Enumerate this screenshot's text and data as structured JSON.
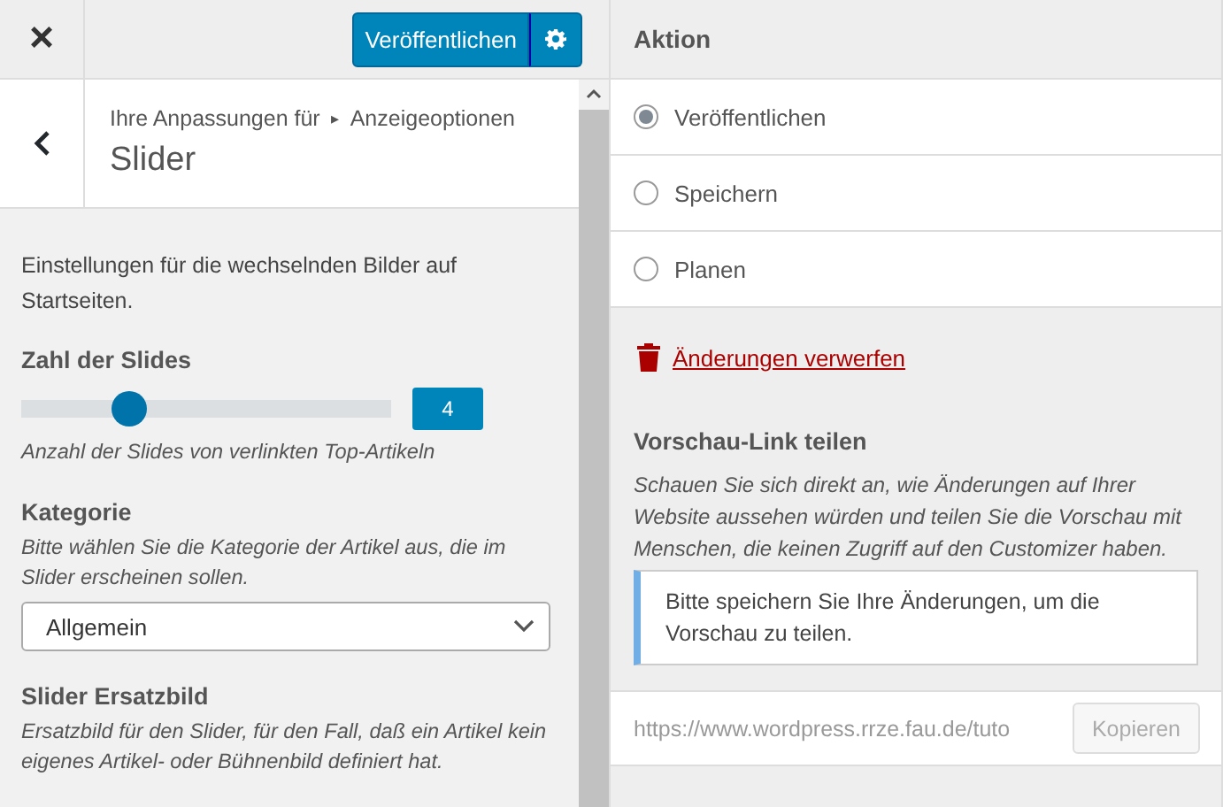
{
  "header": {
    "close": "×",
    "publish_button": "Veröffentlichen"
  },
  "section": {
    "breadcrumb_parent": "Ihre Anpassungen für",
    "breadcrumb_arrow": "▸",
    "breadcrumb_current": "Anzeigeoptionen",
    "title": "Slider"
  },
  "intro": "Einstellungen für die wechselnden Bilder auf Startseiten.",
  "slides_setting": {
    "label": "Zahl der Slides",
    "level": 0.27,
    "value": "4",
    "description": "Anzahl der Slides von verlinkten Top-Artikeln"
  },
  "category_setting": {
    "label": "Kategorie",
    "description": "Bitte wählen Sie die Kategorie der Artikel aus, die im Slider erscheinen sollen.",
    "value": "Allgemein"
  },
  "replacement_image": {
    "label": "Slider Ersatzbild",
    "description": "Ersatzbild für den Slider, für den Fall, daß ein Artikel kein eigenes Artikel- oder Bühnenbild definiert hat."
  },
  "action": {
    "title": "Aktion",
    "options": [
      {
        "label": "Veröffentlichen",
        "selected": true
      },
      {
        "label": "Speichern",
        "selected": false
      },
      {
        "label": "Planen",
        "selected": false
      }
    ],
    "discard_link": "Änderungen verwerfen"
  },
  "preview_link": {
    "title": "Vorschau-Link teilen",
    "description": "Schauen Sie sich direkt an, wie Änderungen auf Ihrer Website aussehen würden und teilen Sie die Vorschau mit Menschen, die keinen Zugriff auf den Customizer haben.",
    "notice": "Bitte speichern Sie Ihre Änderungen, um die Vorschau zu teilen.",
    "url": "https://www.wordpress.rrze.fau.de/tuto",
    "copy_button": "Kopieren"
  }
}
